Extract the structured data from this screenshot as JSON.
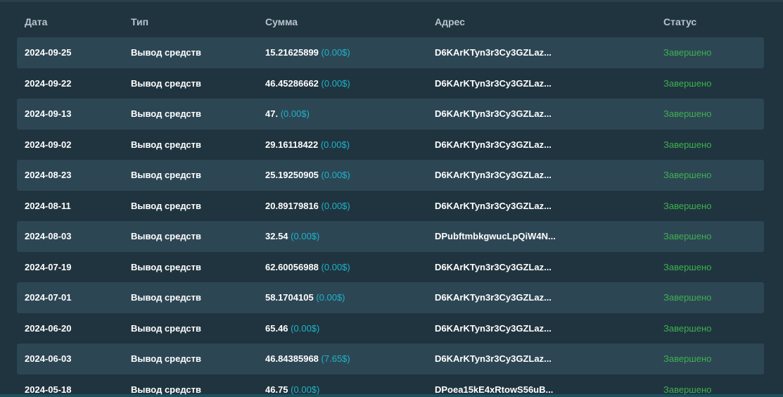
{
  "table": {
    "headers": {
      "date": "Дата",
      "type": "Тип",
      "amount": "Сумма",
      "address": "Адрес",
      "status": "Статус"
    },
    "rows": [
      {
        "date": "2024-09-25",
        "type": "Вывод средств",
        "amount": "15.21625899",
        "usd": "(0.00$)",
        "address": "D6KArKTyn3r3Cy3GZLaz...",
        "status": "Завершено"
      },
      {
        "date": "2024-09-22",
        "type": "Вывод средств",
        "amount": "46.45286662",
        "usd": "(0.00$)",
        "address": "D6KArKTyn3r3Cy3GZLaz...",
        "status": "Завершено"
      },
      {
        "date": "2024-09-13",
        "type": "Вывод средств",
        "amount": "47.",
        "usd": "(0.00$)",
        "address": "D6KArKTyn3r3Cy3GZLaz...",
        "status": "Завершено"
      },
      {
        "date": "2024-09-02",
        "type": "Вывод средств",
        "amount": "29.16118422",
        "usd": "(0.00$)",
        "address": "D6KArKTyn3r3Cy3GZLaz...",
        "status": "Завершено"
      },
      {
        "date": "2024-08-23",
        "type": "Вывод средств",
        "amount": "25.19250905",
        "usd": "(0.00$)",
        "address": "D6KArKTyn3r3Cy3GZLaz...",
        "status": "Завершено"
      },
      {
        "date": "2024-08-11",
        "type": "Вывод средств",
        "amount": "20.89179816",
        "usd": "(0.00$)",
        "address": "D6KArKTyn3r3Cy3GZLaz...",
        "status": "Завершено"
      },
      {
        "date": "2024-08-03",
        "type": "Вывод средств",
        "amount": "32.54",
        "usd": "(0.00$)",
        "address": "DPubftmbkgwucLpQiW4N...",
        "status": "Завершено"
      },
      {
        "date": "2024-07-19",
        "type": "Вывод средств",
        "amount": "62.60056988",
        "usd": "(0.00$)",
        "address": "D6KArKTyn3r3Cy3GZLaz...",
        "status": "Завершено"
      },
      {
        "date": "2024-07-01",
        "type": "Вывод средств",
        "amount": "58.1704105",
        "usd": "(0.00$)",
        "address": "D6KArKTyn3r3Cy3GZLaz...",
        "status": "Завершено"
      },
      {
        "date": "2024-06-20",
        "type": "Вывод средств",
        "amount": "65.46",
        "usd": "(0.00$)",
        "address": "D6KArKTyn3r3Cy3GZLaz...",
        "status": "Завершено"
      },
      {
        "date": "2024-06-03",
        "type": "Вывод средств",
        "amount": "46.84385968",
        "usd": "(7.65$)",
        "address": "D6KArKTyn3r3Cy3GZLaz...",
        "status": "Завершено"
      },
      {
        "date": "2024-05-18",
        "type": "Вывод средств",
        "amount": "46.75",
        "usd": "(0.00$)",
        "address": "DPoea15kE4xRtowS56uB...",
        "status": "Завершено"
      }
    ]
  },
  "colors": {
    "background": "#20343f",
    "row_alt": "#2d4654",
    "usd": "#1db4c8",
    "status_complete": "#3db14f"
  }
}
